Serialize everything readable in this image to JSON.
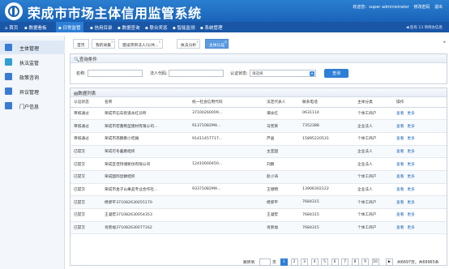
{
  "app": {
    "title": "荣成市市场主体信用监管系统",
    "welcome": [
      "欢迎您：super administrator",
      "修改密码",
      "退出"
    ]
  },
  "menu": {
    "items": [
      "首页",
      "数据看板",
      "日常监管",
      "信用目录",
      "数据查询",
      "联合奖惩",
      "智能监测",
      "系统管理"
    ],
    "active_index": 2,
    "right_text": "◀ 您有 13 项待办信息"
  },
  "sidebar": {
    "items": [
      {
        "label": "主体管理",
        "icon": "building-icon",
        "color": "#3a7bd5"
      },
      {
        "label": "执法监管",
        "icon": "gavel-icon",
        "color": "#2e9fd0"
      },
      {
        "label": "政策咨询",
        "icon": "book-icon",
        "color": "#3a7bd5"
      },
      {
        "label": "异议管理",
        "icon": "chat-icon",
        "color": "#3a7bd5"
      },
      {
        "label": "门户信息",
        "icon": "monitor-icon",
        "color": "#3a7bd5"
      }
    ],
    "active_index": 0
  },
  "tabs": {
    "items": [
      "首页",
      "我的采集",
      "建设项目法人/公共...",
      "执法分析",
      "主体认证"
    ],
    "active_index": 4
  },
  "query": {
    "title": "查询条件",
    "name_label": "名称:",
    "code_label": "法人代码:",
    "status_label": "认证状态:",
    "status_value": "请选择",
    "button": "查询"
  },
  "list": {
    "title": "数据列表",
    "columns": [
      "认证状态",
      "名称",
      "统一社会信用代码",
      "法定代表人",
      "联系电话",
      "主体分类",
      "操作"
    ],
    "rows": [
      [
        "审核通过",
        "荣成市石岛街道永红诊所",
        "37100260009...",
        "谭永红",
        "0631114",
        "个体工商户"
      ],
      [
        "审核通过",
        "荣成市宏鑫制型建材有限公司...",
        "91371082MA...",
        "马宪荣",
        "7352388",
        "企业法人"
      ],
      [
        "审核通过",
        "荣成市高鹏鹏小吃摊",
        "91411457717...",
        "芦晶",
        "15895220531",
        "个体工商户"
      ],
      [
        "已提交",
        "荣成可冬蓄鹏组织",
        "",
        "主亚国",
        "",
        "企业法人"
      ],
      [
        "已提交",
        "荣成宜佳持储新仿有限公司",
        "12410000450...",
        "刘鹏",
        "",
        "企业法人"
      ],
      [
        "已提交",
        "荣成国际鼠鳞组织",
        "",
        "赵小涛",
        "",
        "个体工商户"
      ],
      [
        "已提交",
        "荣成市金子山果品专业合作社...",
        "93371082MA...",
        "王德明",
        "13906302122",
        "企业法人"
      ],
      [
        "已提交",
        "杨郭平371082630055170",
        "",
        "杨郭平",
        "7684315",
        "个体工商户"
      ],
      [
        "已提交",
        "王凝宏371082630054353",
        "",
        "王凝宏",
        "7684315",
        "个体工商户"
      ],
      [
        "已提交",
        "肖民福371082630077162",
        "",
        "肖民福",
        "7684315",
        "个体工商户"
      ]
    ],
    "op_view": "查看",
    "op_more": "更多"
  },
  "pager": {
    "jump_label": "跳转到",
    "page_label": "页",
    "pages": [
      "1",
      "2",
      "3",
      "4",
      "5",
      "6",
      "7",
      "8",
      "9",
      "10"
    ],
    "current": "1",
    "next": "▶",
    "summary": "共6697页，共66965条"
  }
}
